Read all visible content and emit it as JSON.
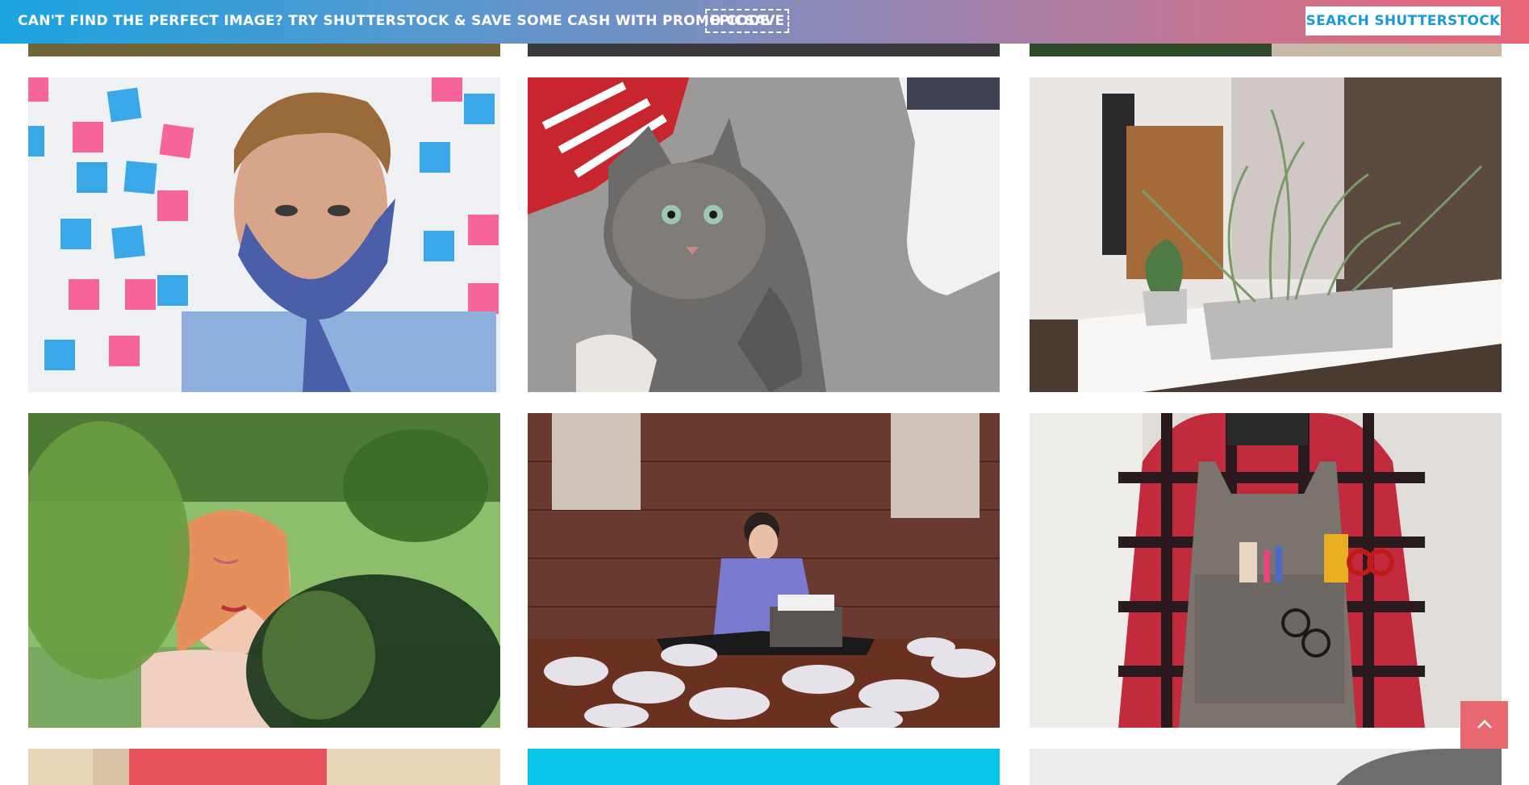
{
  "banner": {
    "message": "CAN'T FIND THE PERFECT IMAGE? TRY SHUTTERSTOCK & SAVE SOME CASH WITH PROMO CODE",
    "promo_code": "EPICSAVE",
    "search_button": "SEARCH SHUTTERSTOCK"
  },
  "gallery": {
    "columns": 3,
    "images": [
      {
        "subject": "grass-path",
        "row": "partial-top"
      },
      {
        "subject": "asphalt",
        "row": "partial-top"
      },
      {
        "subject": "plants",
        "row": "partial-top"
      },
      {
        "subject": "man-with-tie-over-mouth-sticky-notes",
        "row": 1
      },
      {
        "subject": "tabby-cat-between-sneakers",
        "row": 1
      },
      {
        "subject": "succulent-planter-cafe",
        "row": 1
      },
      {
        "subject": "woman-behind-leaves",
        "row": 2
      },
      {
        "subject": "woman-typewriter-crumpled-paper",
        "row": 2
      },
      {
        "subject": "man-plaid-shirt-apron",
        "row": 2
      },
      {
        "subject": "red-door-brick-wall",
        "row": "partial-bottom"
      },
      {
        "subject": "cyan-block",
        "row": "partial-bottom"
      },
      {
        "subject": "grey-portrait",
        "row": "partial-bottom"
      }
    ]
  },
  "scroll_top": {
    "icon": "chevron-up-icon"
  },
  "colors": {
    "banner_start": "#1aa4df",
    "banner_end": "#e96577",
    "scroll_button": "#e86870",
    "search_button_text": "#1a9bd7"
  }
}
